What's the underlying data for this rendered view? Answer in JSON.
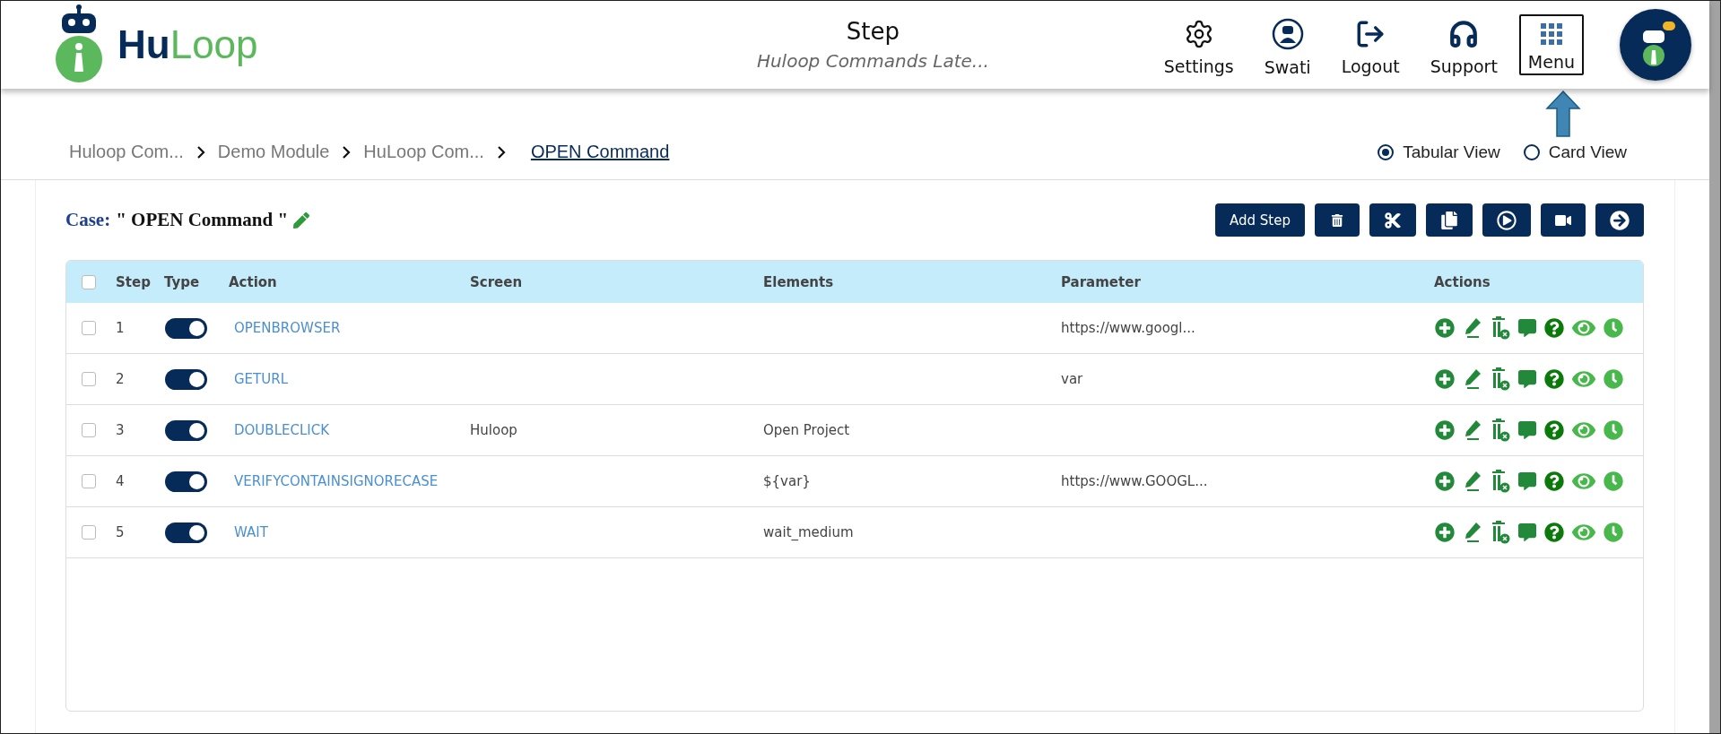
{
  "header": {
    "title": "Step",
    "subtitle": "Huloop Commands Late...",
    "brand": {
      "part_1": "Hu",
      "part_2": "Loop"
    },
    "nav": [
      {
        "kind": "settings",
        "label": "Settings",
        "selected": false
      },
      {
        "kind": "user",
        "label": "Swati",
        "selected": false
      },
      {
        "kind": "logout",
        "label": "Logout",
        "selected": false
      },
      {
        "kind": "support",
        "label": "Support",
        "selected": false
      },
      {
        "kind": "menu",
        "label": "Menu",
        "selected": true
      }
    ]
  },
  "breadcrumb": [
    {
      "label": "Huloop Com...",
      "current": false
    },
    {
      "label": "Demo Module",
      "current": false
    },
    {
      "label": "HuLoop Com...",
      "current": false
    },
    {
      "label": "OPEN Command",
      "current": true
    }
  ],
  "views": [
    {
      "label": "Tabular View",
      "selected": true
    },
    {
      "label": "Card View",
      "selected": false
    }
  ],
  "case": {
    "label": "Case:",
    "name": "\" OPEN Command \""
  },
  "toolbar": [
    {
      "kind": "add",
      "label": "Add Step"
    },
    {
      "kind": "delete"
    },
    {
      "kind": "cut"
    },
    {
      "kind": "copy"
    },
    {
      "kind": "run"
    },
    {
      "kind": "record"
    },
    {
      "kind": "next"
    }
  ],
  "table": {
    "select_all": {
      "checked": false
    },
    "columns": [
      "Step",
      "Type",
      "Action",
      "Screen",
      "Elements",
      "Parameter",
      "Actions"
    ],
    "rows": [
      {
        "checked": false,
        "step": "1",
        "enabled": true,
        "action": "OPENBROWSER",
        "screen": "",
        "elements": "",
        "parameter": "https://www.googl..."
      },
      {
        "checked": false,
        "step": "2",
        "enabled": true,
        "action": "GETURL",
        "screen": "",
        "elements": "",
        "parameter": "var"
      },
      {
        "checked": false,
        "step": "3",
        "enabled": true,
        "action": "DOUBLECLICK",
        "screen": "Huloop",
        "elements": "Open Project",
        "parameter": ""
      },
      {
        "checked": false,
        "step": "4",
        "enabled": true,
        "action": "VERIFYCONTAINSIGNORECASE",
        "screen": "",
        "elements": "${var}",
        "parameter": "https://www.GOOGL..."
      },
      {
        "checked": false,
        "step": "5",
        "enabled": true,
        "action": "WAIT",
        "screen": "",
        "elements": "wait_medium",
        "parameter": ""
      }
    ]
  }
}
